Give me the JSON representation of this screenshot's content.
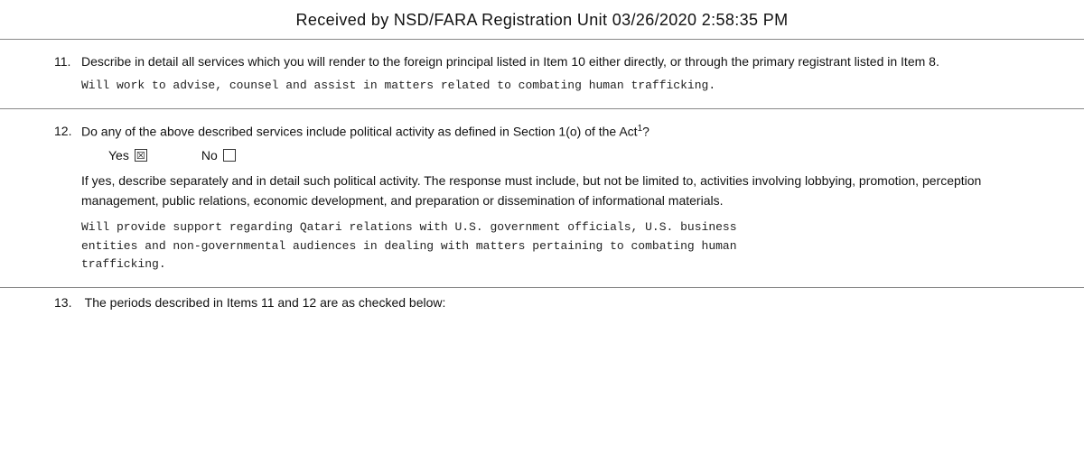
{
  "header": {
    "text": "Received by NSD/FARA Registration Unit   03/26/2020   2:58:35 PM"
  },
  "section11": {
    "number": "11.",
    "title": "Describe in detail all services which you will render to the foreign principal listed in Item 10 either directly, or through the primary registrant listed in Item 8.",
    "response": "Will work to advise, counsel and assist in matters related to combating human trafficking."
  },
  "section12": {
    "number": "12.",
    "title_part1": "Do any of the above described services include political activity as defined in Section 1(o) of the Act",
    "title_superscript": "1",
    "title_part2": "?",
    "yes_label": "Yes",
    "yes_checked": true,
    "no_label": "No",
    "no_checked": false,
    "if_yes_text": "If yes, describe separately and in detail such political activity. The response must include, but not be limited to, activities involving lobbying, promotion, perception management, public relations, economic development, and preparation or dissemination of informational materials.",
    "response_line1": "Will provide support regarding Qatari relations with U.S. government officials, U.S. business",
    "response_line2": "entities and non-governmental audiences in dealing with matters pertaining to combating human",
    "response_line3": "trafficking."
  },
  "section13_partial": {
    "number": "13.",
    "text": "The periods described in Items 11 and 12 are as checked below:"
  }
}
